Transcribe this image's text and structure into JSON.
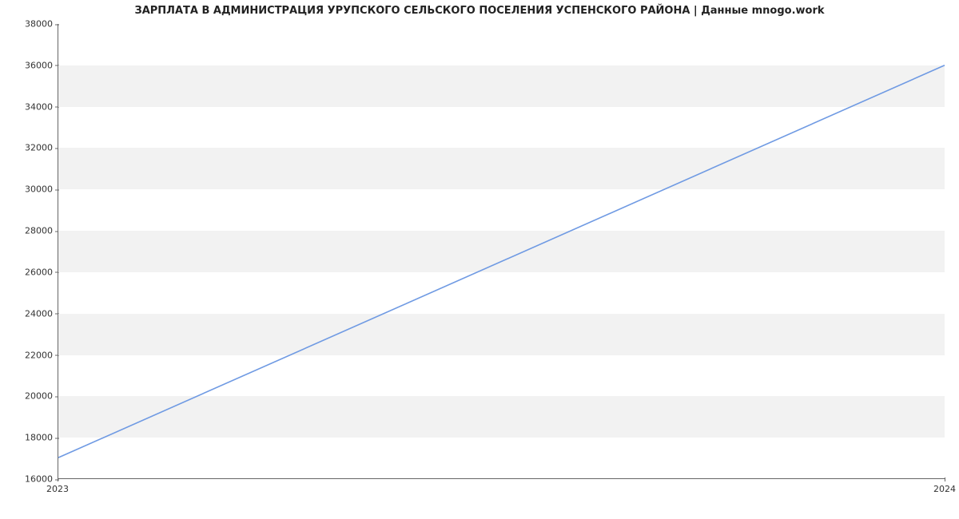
{
  "chart_data": {
    "type": "line",
    "title": "ЗАРПЛАТА В АДМИНИСТРАЦИЯ УРУПСКОГО СЕЛЬСКОГО ПОСЕЛЕНИЯ УСПЕНСКОГО РАЙОНА | Данные mnogo.work",
    "x": [
      2023,
      2024
    ],
    "values": [
      17000,
      36000
    ],
    "xlabel": "",
    "ylabel": "",
    "xticks": [
      "2023",
      "2024"
    ],
    "yticks": [
      16000,
      18000,
      20000,
      22000,
      24000,
      26000,
      28000,
      30000,
      32000,
      34000,
      36000,
      38000
    ],
    "ylim": [
      16000,
      38000
    ],
    "xlim": [
      2023,
      2024
    ],
    "series_color": "#6f9ae3"
  }
}
